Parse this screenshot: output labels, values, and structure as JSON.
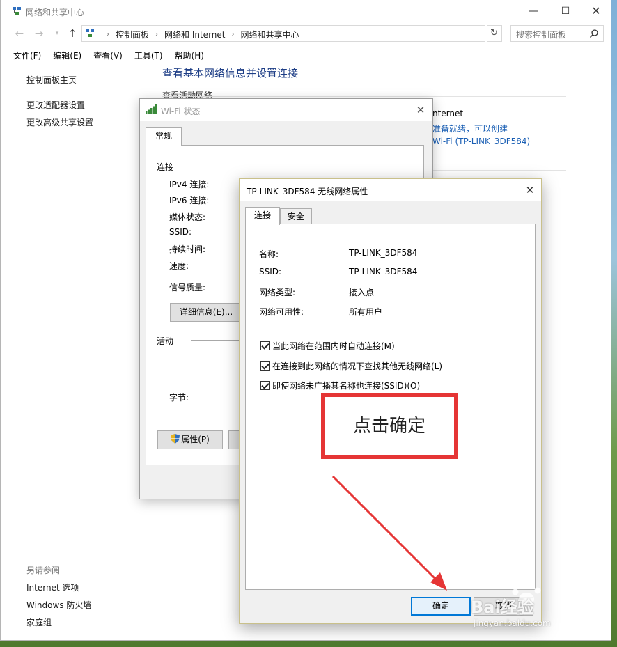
{
  "main_window": {
    "title": "网络和共享中心",
    "breadcrumbs": [
      "控制面板",
      "网络和 Internet",
      "网络和共享中心"
    ],
    "search_placeholder": "搜索控制面板",
    "menu": [
      "文件(F)",
      "编辑(E)",
      "查看(V)",
      "工具(T)",
      "帮助(H)"
    ],
    "left_links": [
      "控制面板主页",
      "更改适配器设置",
      "更改高级共享设置"
    ],
    "see_also": {
      "header": "另请参阅",
      "links": [
        "Internet 选项",
        "Windows 防火墙",
        "家庭组"
      ]
    },
    "heading": "查看基本网络信息并设置连接",
    "active_networks_label": "查看活动网络",
    "network_partial": [
      "nternet",
      "准备就绪，可以创建",
      "Wi-Fi (TP-LINK_3DF584)"
    ]
  },
  "wifi_status": {
    "title": "Wi-Fi 状态",
    "tab": "常规",
    "connection_group": "连接",
    "fields": [
      "IPv4 连接:",
      "IPv6 连接:",
      "媒体状态:",
      "SSID:",
      "持续时间:",
      "速度:"
    ],
    "signal_label": "信号质量:",
    "details_button": "详细信息(E)...",
    "activity_group": "活动",
    "bytes_label": "字节:",
    "properties_button": "属性(P)"
  },
  "props_dialog": {
    "title": "TP-LINK_3DF584 无线网络属性",
    "tabs": [
      "连接",
      "安全"
    ],
    "info": [
      {
        "label": "名称:",
        "value": "TP-LINK_3DF584"
      },
      {
        "label": "SSID:",
        "value": "TP-LINK_3DF584"
      },
      {
        "label": "网络类型:",
        "value": "接入点"
      },
      {
        "label": "网络可用性:",
        "value": "所有用户"
      }
    ],
    "checkboxes": [
      {
        "label": "当此网络在范围内时自动连接(M)",
        "checked": true
      },
      {
        "label": "在连接到此网络的情况下查找其他无线网络(L)",
        "checked": true
      },
      {
        "label": "即使网络未广播其名称也连接(SSID)(O)",
        "checked": true
      }
    ],
    "ok_button": "确定",
    "cancel_button": "取消"
  },
  "annotation": {
    "text": "点击确定",
    "color": "#e53535"
  },
  "watermark": {
    "text": "Bai经验",
    "url": "jingyan.baidu.com"
  }
}
